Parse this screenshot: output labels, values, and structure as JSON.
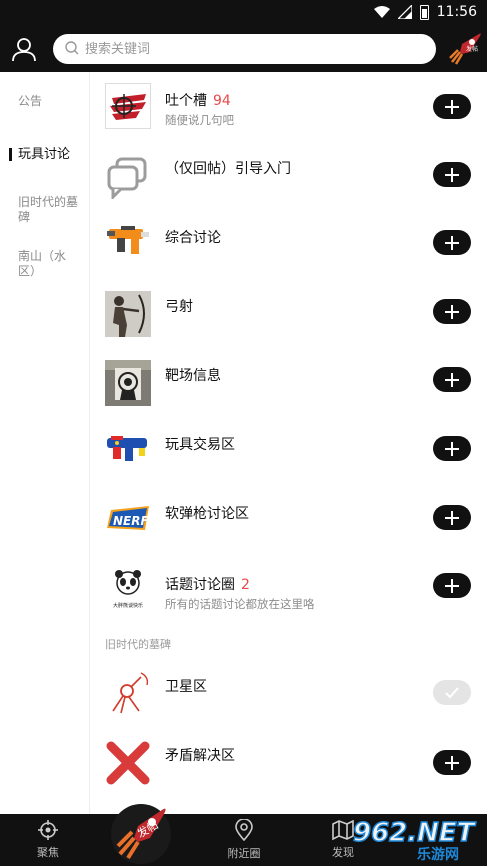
{
  "status": {
    "time": "11:56"
  },
  "search": {
    "placeholder": "搜索关键词"
  },
  "top_rocket_label": "发帖",
  "sidebar": {
    "items": [
      {
        "label": "公告"
      },
      {
        "label": "玩具讨论"
      },
      {
        "label": "旧时代的墓碑"
      },
      {
        "label": "南山（水区）"
      }
    ]
  },
  "forums": [
    {
      "name": "吐个槽",
      "count": "94",
      "desc": "随便说几句吧",
      "icon": "wing-logo-icon",
      "joined": false
    },
    {
      "name": "（仅回帖）引导入门",
      "count": "",
      "desc": "",
      "icon": "chat-bubbles-icon",
      "joined": false
    },
    {
      "name": "综合讨论",
      "count": "",
      "desc": "",
      "icon": "blaster-icon",
      "joined": false
    },
    {
      "name": "弓射",
      "count": "",
      "desc": "",
      "icon": "archer-icon",
      "joined": false
    },
    {
      "name": "靶场信息",
      "count": "",
      "desc": "",
      "icon": "target-icon",
      "joined": false
    },
    {
      "name": "玩具交易区",
      "count": "",
      "desc": "",
      "icon": "blue-blaster-icon",
      "joined": false
    },
    {
      "name": "软弹枪讨论区",
      "count": "",
      "desc": "",
      "icon": "nerf-logo-icon",
      "joined": false
    },
    {
      "name": "话题讨论圈",
      "count": "2",
      "desc": "所有的话题讨论都放在这里咯",
      "icon": "panda-logo-icon",
      "joined": false
    }
  ],
  "section2": {
    "label": "旧时代的墓碑"
  },
  "forums2": [
    {
      "name": "卫星区",
      "count": "",
      "desc": "",
      "icon": "satellite-icon",
      "joined": true
    },
    {
      "name": "矛盾解决区",
      "count": "",
      "desc": "",
      "icon": "red-x-icon",
      "joined": false
    }
  ],
  "panda_caption": "大胖熊谈快乐",
  "nerf_text": "NERF",
  "bottom_tabs": [
    {
      "label": "聚焦",
      "icon": "crosshair-icon"
    },
    {
      "label": "发帖",
      "icon": "rocket-icon"
    },
    {
      "label": "附近圈",
      "icon": "location-pin-icon"
    },
    {
      "label": "发现",
      "icon": "map-icon"
    }
  ],
  "watermark": {
    "text": "962.NET",
    "sub": "乐游网"
  },
  "colors": {
    "bar": "#111111",
    "accent_red": "#e84a4a",
    "rocket": "#c0282d"
  }
}
